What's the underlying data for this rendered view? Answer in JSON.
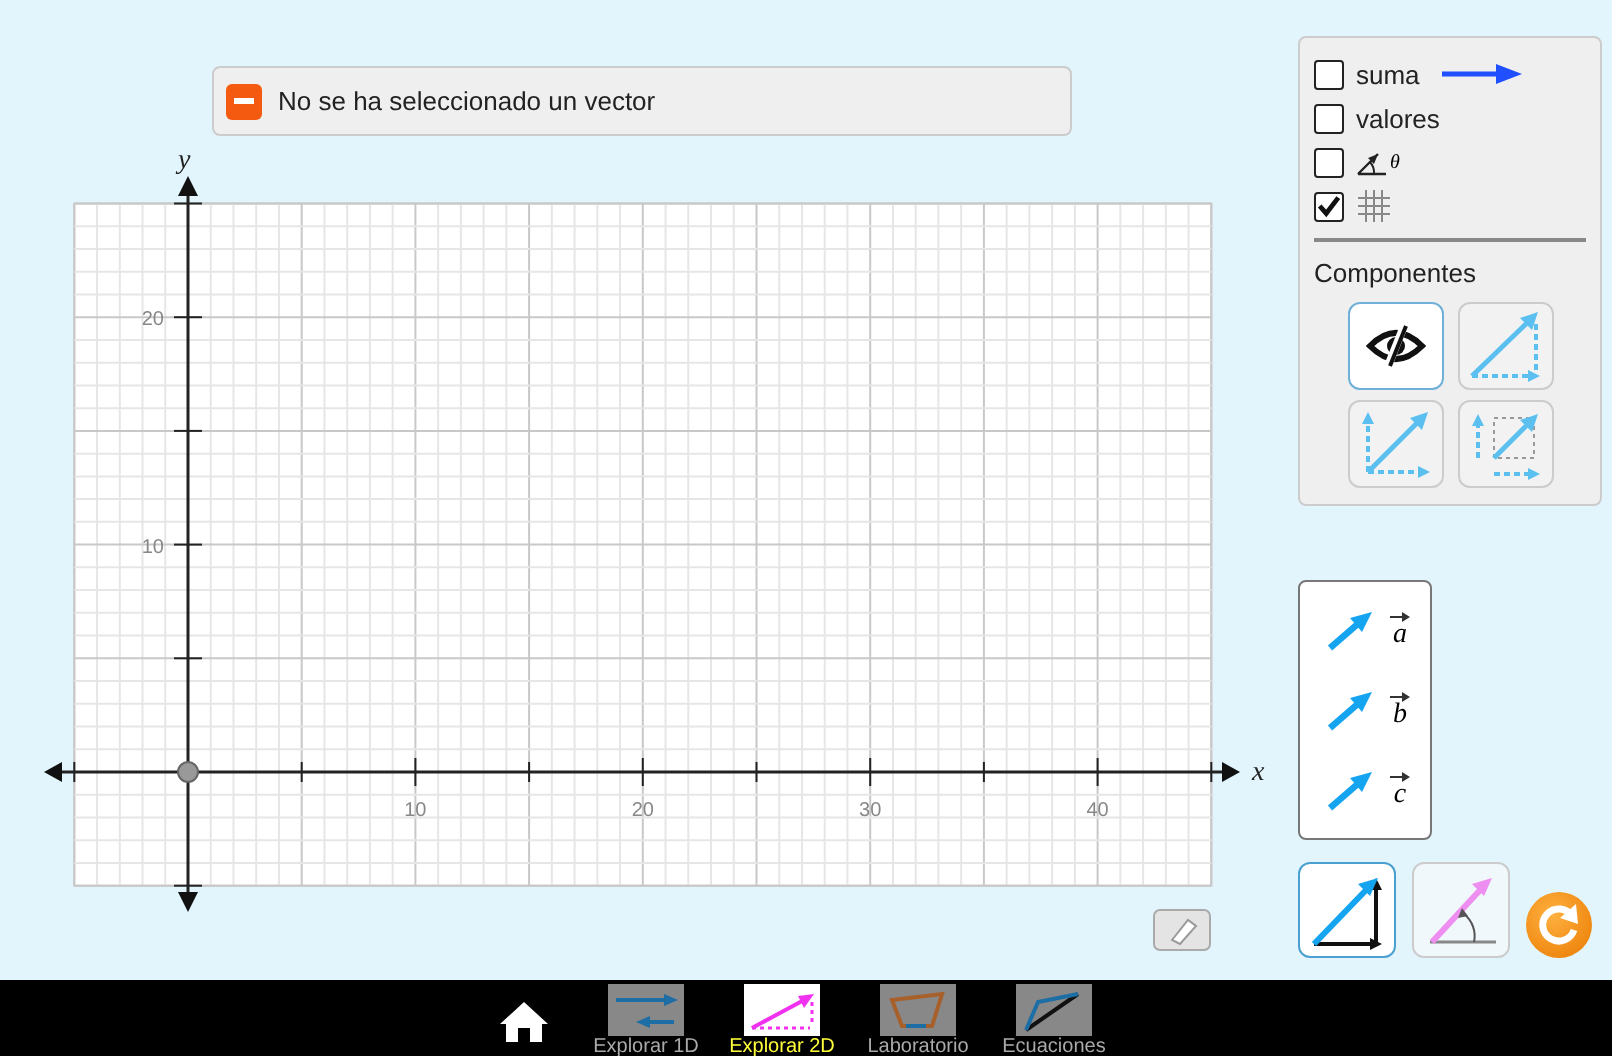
{
  "message": {
    "text": "No se ha seleccionado un vector"
  },
  "graph": {
    "x_label": "x",
    "y_label": "y",
    "x_ticks": [
      "10",
      "20",
      "30",
      "40"
    ],
    "y_ticks": [
      "20",
      "10"
    ]
  },
  "options": [
    {
      "kind": "sum",
      "label": "suma",
      "checked": false
    },
    {
      "kind": "values",
      "label": "valores",
      "checked": false
    },
    {
      "kind": "angle",
      "label": "θ",
      "checked": false
    },
    {
      "kind": "grid",
      "checked": true
    }
  ],
  "components": {
    "title": "Componentes",
    "buttons": [
      {
        "kind": "hidden",
        "selected": true
      },
      {
        "kind": "triangle",
        "selected": false
      },
      {
        "kind": "parallelogram",
        "selected": false
      },
      {
        "kind": "projection",
        "selected": false
      }
    ]
  },
  "vectors": [
    {
      "label": "a"
    },
    {
      "label": "b"
    },
    {
      "label": "c"
    }
  ],
  "modes": [
    {
      "kind": "cartesian",
      "selected": true
    },
    {
      "kind": "polar",
      "selected": false
    }
  ],
  "nav": [
    {
      "kind": "linear",
      "label": "Explorar 1D",
      "selected": false
    },
    {
      "kind": "planar",
      "label": "Explorar 2D",
      "selected": true
    },
    {
      "kind": "lab",
      "label": "Laboratorio",
      "selected": false
    },
    {
      "kind": "eq",
      "label": "Ecuaciones",
      "selected": false
    }
  ]
}
